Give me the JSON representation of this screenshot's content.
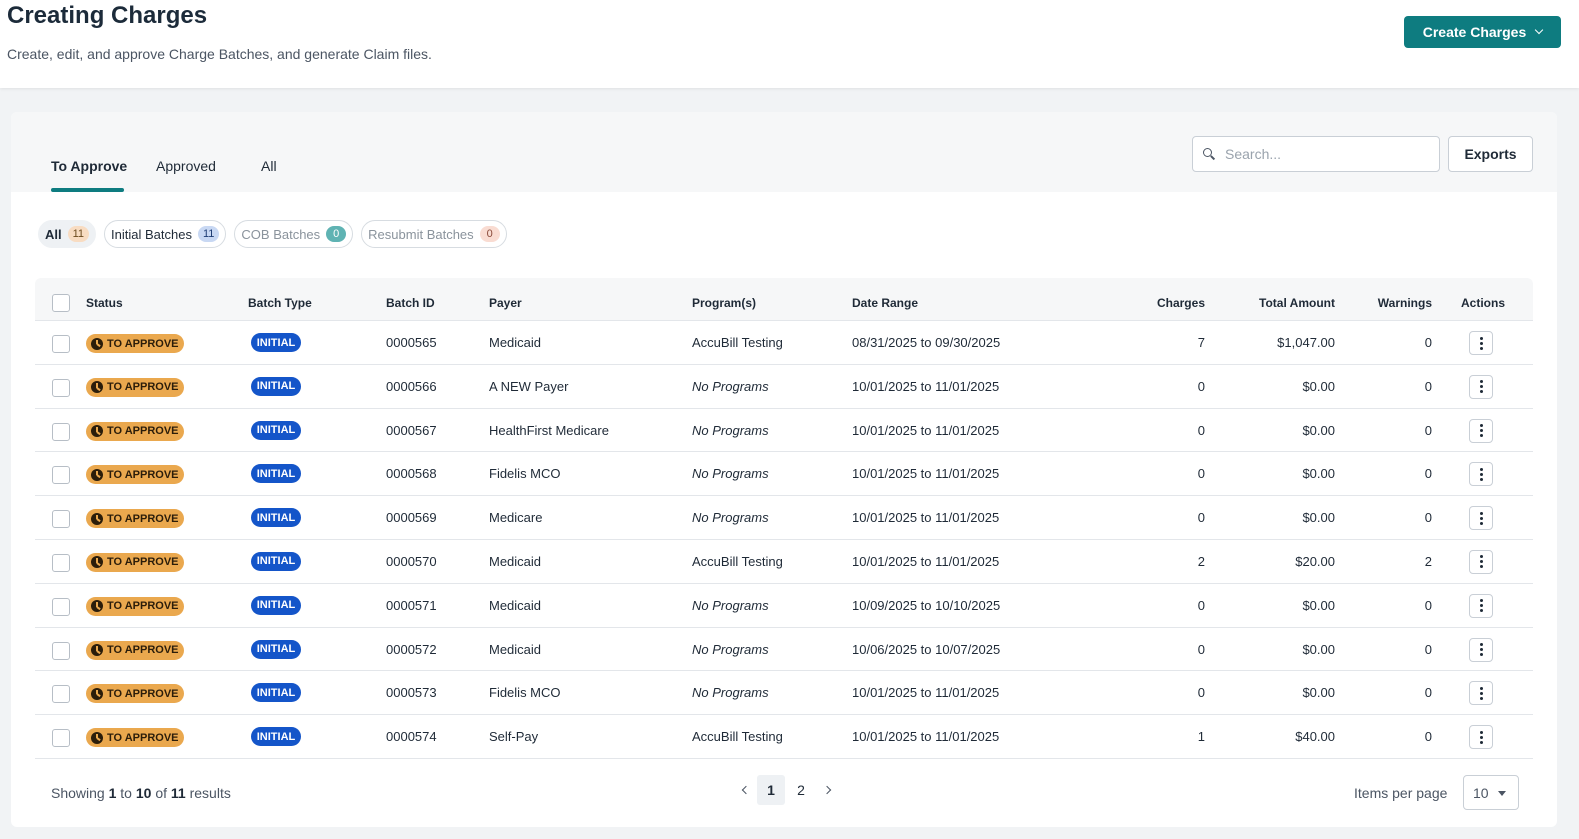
{
  "header": {
    "title": "Creating Charges",
    "subtitle": "Create, edit, and approve Charge Batches, and generate Claim files.",
    "create_button": "Create Charges",
    "accent": "#0e7c80"
  },
  "tabs": [
    {
      "label": "To Approve",
      "active": true
    },
    {
      "label": "Approved",
      "active": false
    },
    {
      "label": "All",
      "active": false
    }
  ],
  "search": {
    "placeholder": "Search...",
    "value": ""
  },
  "exports_label": "Exports",
  "filters": [
    {
      "label": "All",
      "count": "11",
      "count_bg": "#f8dcc2",
      "count_color": "#6b4a1e"
    },
    {
      "label": "Initial Batches",
      "count": "11",
      "count_bg": "#c8d8f3",
      "count_color": "#1d3b73"
    },
    {
      "label": "COB Batches",
      "count": "0",
      "count_bg": "#5fb3b3",
      "count_color": "#ffffff"
    },
    {
      "label": "Resubmit Batches",
      "count": "0",
      "count_bg": "#f9dcd2",
      "count_color": "#8a4a3a"
    }
  ],
  "table": {
    "columns": {
      "status": "Status",
      "batch_type": "Batch Type",
      "batch_id": "Batch ID",
      "payer": "Payer",
      "programs": "Program(s)",
      "date_range": "Date Range",
      "charges": "Charges",
      "total_amount": "Total Amount",
      "warnings": "Warnings",
      "actions": "Actions"
    },
    "rows": [
      {
        "status": "TO APPROVE",
        "type": "INITIAL",
        "id": "0000565",
        "payer": "Medicaid",
        "programs": "AccuBill Testing",
        "no_program": false,
        "date_range": "08/31/2025 to 09/30/2025",
        "charges": "7",
        "total": "$1,047.00",
        "warnings": "0"
      },
      {
        "status": "TO APPROVE",
        "type": "INITIAL",
        "id": "0000566",
        "payer": "A NEW Payer",
        "programs": "No Programs",
        "no_program": true,
        "date_range": "10/01/2025 to 11/01/2025",
        "charges": "0",
        "total": "$0.00",
        "warnings": "0"
      },
      {
        "status": "TO APPROVE",
        "type": "INITIAL",
        "id": "0000567",
        "payer": "HealthFirst Medicare",
        "programs": "No Programs",
        "no_program": true,
        "date_range": "10/01/2025 to 11/01/2025",
        "charges": "0",
        "total": "$0.00",
        "warnings": "0"
      },
      {
        "status": "TO APPROVE",
        "type": "INITIAL",
        "id": "0000568",
        "payer": "Fidelis MCO",
        "programs": "No Programs",
        "no_program": true,
        "date_range": "10/01/2025 to 11/01/2025",
        "charges": "0",
        "total": "$0.00",
        "warnings": "0"
      },
      {
        "status": "TO APPROVE",
        "type": "INITIAL",
        "id": "0000569",
        "payer": "Medicare",
        "programs": "No Programs",
        "no_program": true,
        "date_range": "10/01/2025 to 11/01/2025",
        "charges": "0",
        "total": "$0.00",
        "warnings": "0"
      },
      {
        "status": "TO APPROVE",
        "type": "INITIAL",
        "id": "0000570",
        "payer": "Medicaid",
        "programs": "AccuBill Testing",
        "no_program": false,
        "date_range": "10/01/2025 to 11/01/2025",
        "charges": "2",
        "total": "$20.00",
        "warnings": "2"
      },
      {
        "status": "TO APPROVE",
        "type": "INITIAL",
        "id": "0000571",
        "payer": "Medicaid",
        "programs": "No Programs",
        "no_program": true,
        "date_range": "10/09/2025 to 10/10/2025",
        "charges": "0",
        "total": "$0.00",
        "warnings": "0"
      },
      {
        "status": "TO APPROVE",
        "type": "INITIAL",
        "id": "0000572",
        "payer": "Medicaid",
        "programs": "No Programs",
        "no_program": true,
        "date_range": "10/06/2025 to 10/07/2025",
        "charges": "0",
        "total": "$0.00",
        "warnings": "0"
      },
      {
        "status": "TO APPROVE",
        "type": "INITIAL",
        "id": "0000573",
        "payer": "Fidelis MCO",
        "programs": "No Programs",
        "no_program": true,
        "date_range": "10/01/2025 to 11/01/2025",
        "charges": "0",
        "total": "$0.00",
        "warnings": "0"
      },
      {
        "status": "TO APPROVE",
        "type": "INITIAL",
        "id": "0000574",
        "payer": "Self-Pay",
        "programs": "AccuBill Testing",
        "no_program": false,
        "date_range": "10/01/2025 to 11/01/2025",
        "charges": "1",
        "total": "$40.00",
        "warnings": "0"
      }
    ]
  },
  "footer": {
    "showing_prefix": "Showing",
    "range_from": "1",
    "to_word": "to",
    "range_to": "10",
    "of_word": "of",
    "total": "11",
    "results_word": "results",
    "pages": [
      "1",
      "2"
    ],
    "current_page": "1",
    "items_per_page_label": "Items per page",
    "items_per_page_value": "10"
  }
}
